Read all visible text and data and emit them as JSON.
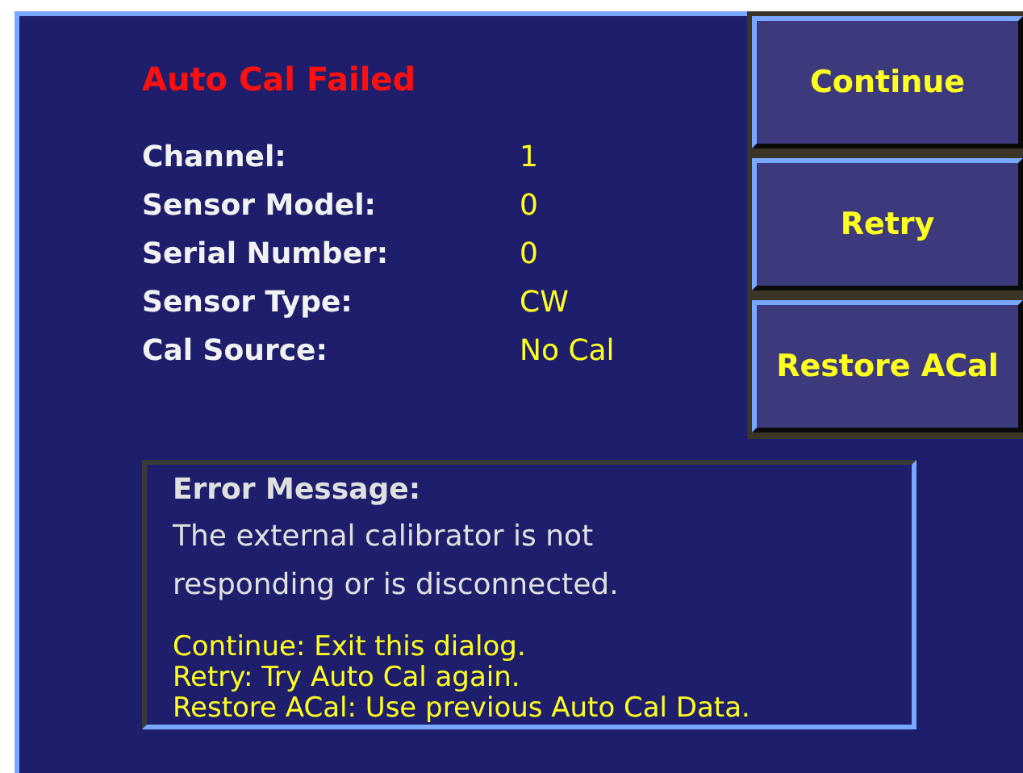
{
  "dialog": {
    "title": "Auto Cal Failed",
    "fields": [
      {
        "label": "Channel:",
        "value": "1"
      },
      {
        "label": "Sensor Model:",
        "value": "0"
      },
      {
        "label": "Serial Number:",
        "value": "0"
      },
      {
        "label": "Sensor Type:",
        "value": "CW"
      },
      {
        "label": "Cal Source:",
        "value": "No Cal"
      }
    ],
    "buttons": [
      "Continue",
      "Retry",
      "Restore ACal"
    ],
    "error_box": {
      "heading": "Error Message:",
      "message": "The external calibrator is not responding or is disconnected.",
      "help": [
        "Continue: Exit this dialog.",
        "Retry: Try Auto Cal again.",
        "Restore ACal: Use previous Auto Cal Data."
      ]
    }
  }
}
